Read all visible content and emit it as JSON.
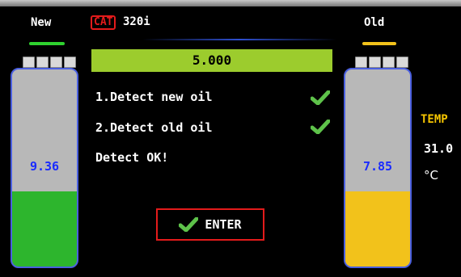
{
  "header": {
    "new_label": "New",
    "old_label": "Old",
    "cat_badge": "CAT",
    "model": "320i"
  },
  "status_bar": {
    "value": "5.000"
  },
  "steps": [
    {
      "label": "1.Detect new oil",
      "done": true
    },
    {
      "label": "2.Detect old oil",
      "done": true
    }
  ],
  "result": "Detect OK!",
  "tanks": {
    "new": {
      "value": "9.36",
      "level": 0.38,
      "color": "#2db52d"
    },
    "old": {
      "value": "7.85",
      "level": 0.38,
      "color": "#f2c21b"
    }
  },
  "temperature": {
    "label": "TEMP",
    "value": "31.0",
    "unit": "°C"
  },
  "enter_button": {
    "label": "ENTER"
  },
  "colors": {
    "accent_green": "#9ccc2d",
    "border_blue": "#4a5fe0",
    "alert_red": "#e31b1b",
    "temp_yellow": "#f5c400"
  }
}
